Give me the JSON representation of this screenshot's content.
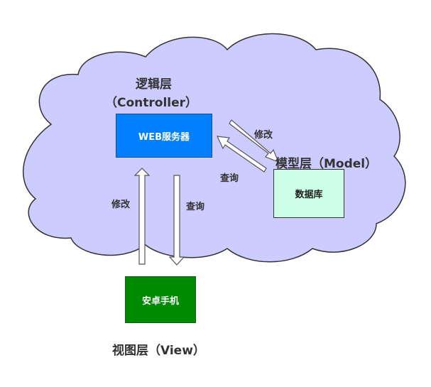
{
  "layers": {
    "logic_title": "逻辑层",
    "logic_subtitle": "（Controller）",
    "model_title": "模型层（Model）",
    "view_title": "视图层（View）"
  },
  "nodes": {
    "web_server": "WEB服务器",
    "database": "数据库",
    "android_phone": "安卓手机"
  },
  "edges": {
    "server_to_db": "修改",
    "db_to_server": "查询",
    "phone_to_server": "修改",
    "server_to_phone": "查询"
  },
  "colors": {
    "cloud_fill": "#ccccff",
    "cloud_stroke": "#333333",
    "web_server_fill": "#007fff",
    "database_fill": "#ccffe6",
    "android_phone_fill": "#008a00",
    "arrow_fill": "#ffffff",
    "arrow_stroke": "#555555"
  }
}
